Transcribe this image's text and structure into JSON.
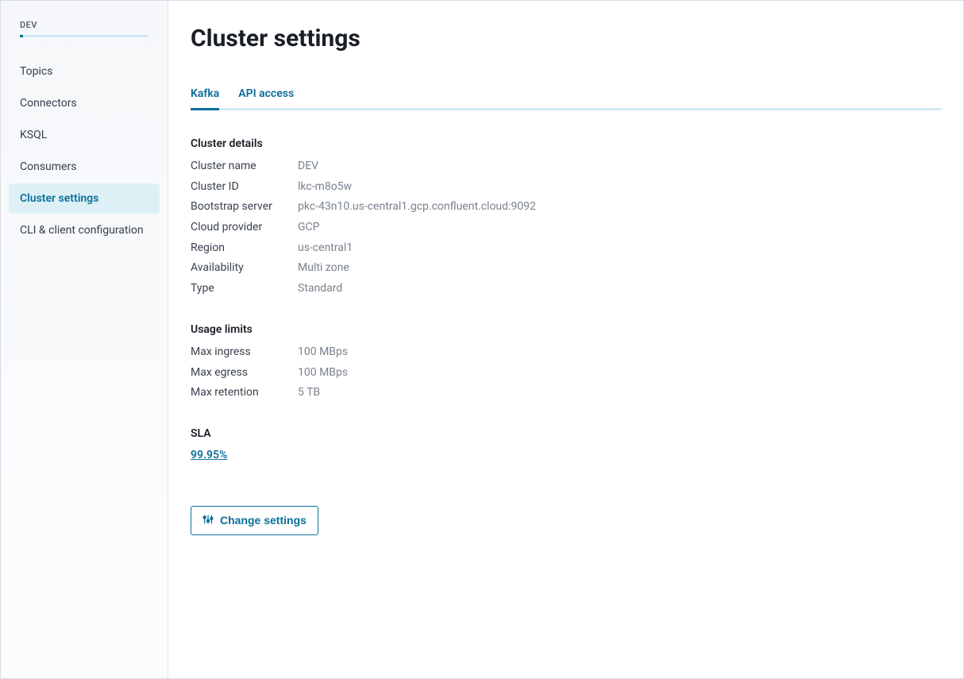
{
  "sidebar": {
    "header": "DEV",
    "items": [
      {
        "label": "Topics",
        "active": false
      },
      {
        "label": "Connectors",
        "active": false
      },
      {
        "label": "KSQL",
        "active": false
      },
      {
        "label": "Consumers",
        "active": false
      },
      {
        "label": "Cluster settings",
        "active": true
      },
      {
        "label": "CLI & client configuration",
        "active": false
      }
    ]
  },
  "page": {
    "title": "Cluster settings"
  },
  "tabs": [
    {
      "label": "Kafka",
      "active": true
    },
    {
      "label": "API access",
      "active": false
    }
  ],
  "cluster_details": {
    "title": "Cluster details",
    "rows": [
      {
        "key": "Cluster name",
        "val": "DEV"
      },
      {
        "key": "Cluster ID",
        "val": "lkc-m8o5w"
      },
      {
        "key": "Bootstrap server",
        "val": "pkc-43n10.us-central1.gcp.confluent.cloud:9092"
      },
      {
        "key": "Cloud provider",
        "val": "GCP"
      },
      {
        "key": "Region",
        "val": "us-central1"
      },
      {
        "key": "Availability",
        "val": "Multi zone"
      },
      {
        "key": "Type",
        "val": "Standard"
      }
    ]
  },
  "usage_limits": {
    "title": "Usage limits",
    "rows": [
      {
        "key": "Max ingress",
        "val": "100 MBps"
      },
      {
        "key": "Max egress",
        "val": "100 MBps"
      },
      {
        "key": "Max retention",
        "val": "5 TB"
      }
    ]
  },
  "sla": {
    "title": "SLA",
    "link_text": "99.95%"
  },
  "change_button": {
    "label": "Change settings"
  }
}
